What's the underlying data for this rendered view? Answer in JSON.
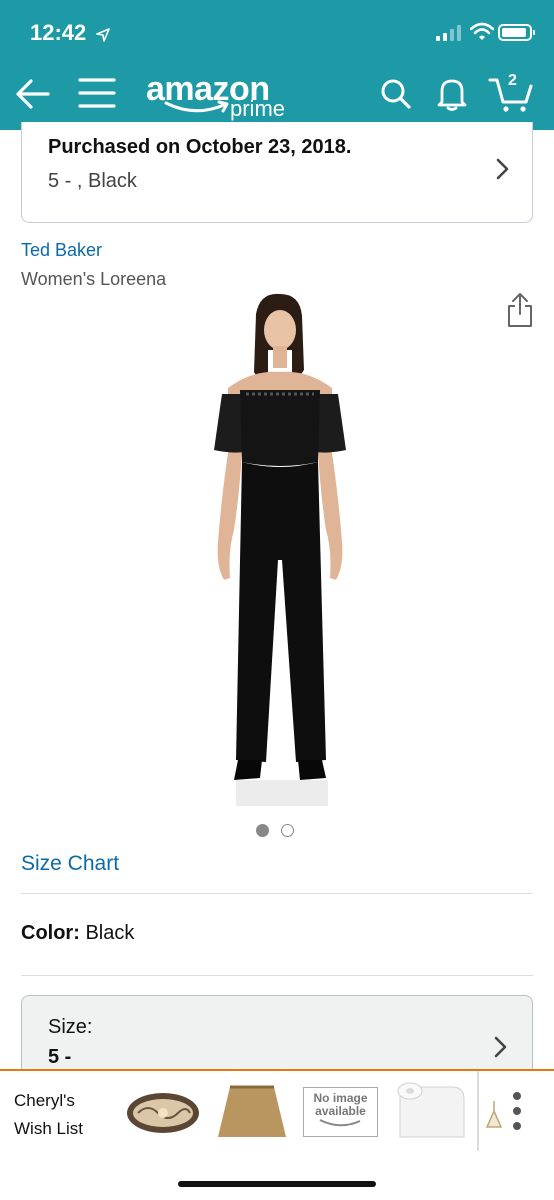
{
  "status_bar": {
    "time": "12:42"
  },
  "app_bar": {
    "logo_word": "amazon",
    "logo_sub": "prime",
    "cart_count": "2"
  },
  "order": {
    "purchased": "Purchased on October 23, 2018.",
    "details": "5 - , Black"
  },
  "product": {
    "brand": "Ted Baker",
    "name": "Women's Loreena"
  },
  "size_chart": "Size Chart",
  "color": {
    "label": "Color:",
    "value": "Black"
  },
  "size": {
    "label": "Size:",
    "value": "5 -"
  },
  "wish_list": {
    "label_line1": "Cheryl's",
    "label_line2": "Wish List",
    "no_image_line1": "No image",
    "no_image_line2": "available"
  },
  "colors": {
    "header": "#1d9aa6",
    "link": "#0b6aa8",
    "accent": "#e47911"
  }
}
